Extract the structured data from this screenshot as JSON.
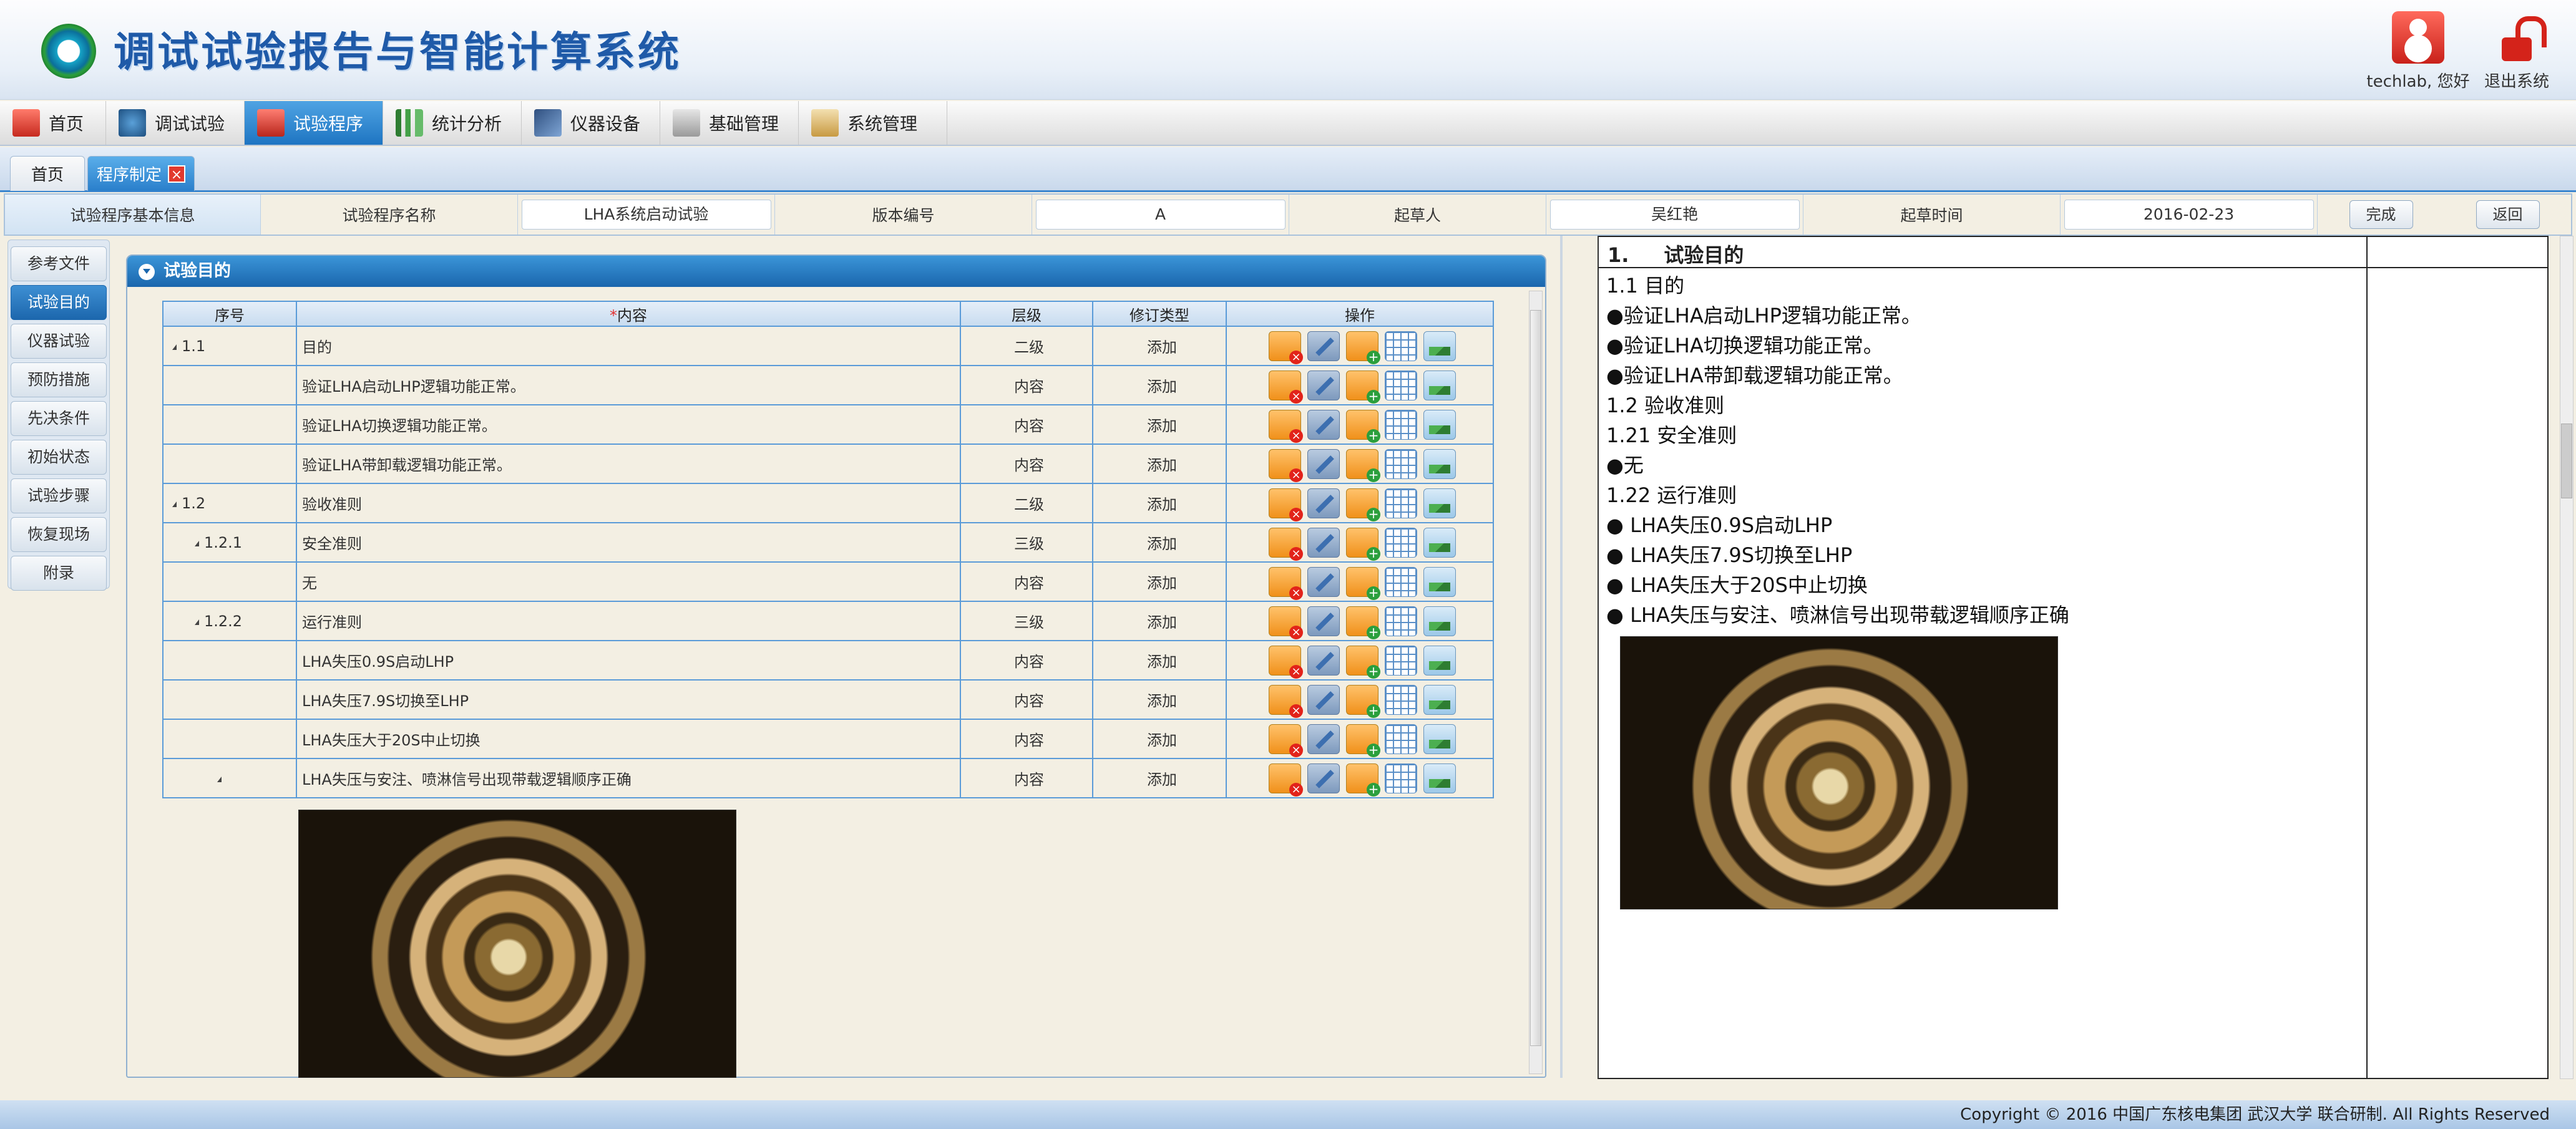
{
  "app": {
    "title": "调试试验报告与智能计算系统",
    "user": "techlab, 您好",
    "logout": "退出系统"
  },
  "nav": [
    "首页",
    "调试试验",
    "试验程序",
    "统计分析",
    "仪器设备",
    "基础管理",
    "系统管理"
  ],
  "nav_active": "试验程序",
  "subtabs": {
    "home": "首页",
    "current": "程序制定",
    "close": "×"
  },
  "info": {
    "section": "试验程序基本信息",
    "name_label": "试验程序名称",
    "name_value": "LHA系统启动试验",
    "version_label": "版本编号",
    "version_value": "A",
    "author_label": "起草人",
    "author_value": "吴红艳",
    "date_label": "起草时间",
    "date_value": "2016-02-23",
    "done": "完成",
    "back": "返回"
  },
  "sidebar": [
    "参考文件",
    "试验目的",
    "仪器试验",
    "预防措施",
    "先决条件",
    "初始状态",
    "试验步骤",
    "恢复现场",
    "附录"
  ],
  "sidebar_active": "试验目的",
  "panel": {
    "title": "试验目的"
  },
  "table": {
    "headers": {
      "seq": "序号",
      "req": "*",
      "content": "内容",
      "level": "层级",
      "revision": "修订类型",
      "ops": "操作"
    },
    "rows": [
      {
        "seq": "1.1",
        "tri": true,
        "indent": 0,
        "content": "目的",
        "level": "二级",
        "rev": "添加"
      },
      {
        "seq": "",
        "tri": false,
        "indent": 0,
        "content": "验证LHA启动LHP逻辑功能正常。",
        "level": "内容",
        "rev": "添加"
      },
      {
        "seq": "",
        "tri": false,
        "indent": 0,
        "content": "验证LHA切换逻辑功能正常。",
        "level": "内容",
        "rev": "添加"
      },
      {
        "seq": "",
        "tri": false,
        "indent": 0,
        "content": "验证LHA带卸载逻辑功能正常。",
        "level": "内容",
        "rev": "添加"
      },
      {
        "seq": "1.2",
        "tri": true,
        "indent": 0,
        "content": "验收准则",
        "level": "二级",
        "rev": "添加"
      },
      {
        "seq": "1.2.1",
        "tri": true,
        "indent": 1,
        "content": "安全准则",
        "level": "三级",
        "rev": "添加"
      },
      {
        "seq": "",
        "tri": false,
        "indent": 0,
        "content": "无",
        "level": "内容",
        "rev": "添加"
      },
      {
        "seq": "1.2.2",
        "tri": true,
        "indent": 1,
        "content": "运行准则",
        "level": "三级",
        "rev": "添加"
      },
      {
        "seq": "",
        "tri": false,
        "indent": 0,
        "content": "LHA失压0.9S启动LHP",
        "level": "内容",
        "rev": "添加"
      },
      {
        "seq": "",
        "tri": false,
        "indent": 0,
        "content": "LHA失压7.9S切换至LHP",
        "level": "内容",
        "rev": "添加"
      },
      {
        "seq": "",
        "tri": false,
        "indent": 0,
        "content": "LHA失压大于20S中止切换",
        "level": "内容",
        "rev": "添加"
      },
      {
        "seq": "",
        "tri": true,
        "indent": 2,
        "content": "LHA失压与安注、喷淋信号出现带载逻辑顺序正确",
        "level": "内容",
        "rev": "添加"
      }
    ]
  },
  "preview": {
    "num": "1.",
    "title": "试验目的",
    "lines": [
      "1.1  目的",
      "●验证LHA启动LHP逻辑功能正常。",
      "●验证LHA切换逻辑功能正常。",
      "●验证LHA带卸载逻辑功能正常。",
      "1.2  验收准则",
      "1.21  安全准则",
      "●无",
      "1.22  运行准则",
      "● LHA失压0.9S启动LHP",
      "● LHA失压7.9S切换至LHP",
      "● LHA失压大于20S中止切换",
      "● LHA失压与安注、喷淋信号出现带载逻辑顺序正确"
    ]
  },
  "footer": "Copyright © 2016 中国广东核电集团 武汉大学 联合研制. All Rights Reserved"
}
